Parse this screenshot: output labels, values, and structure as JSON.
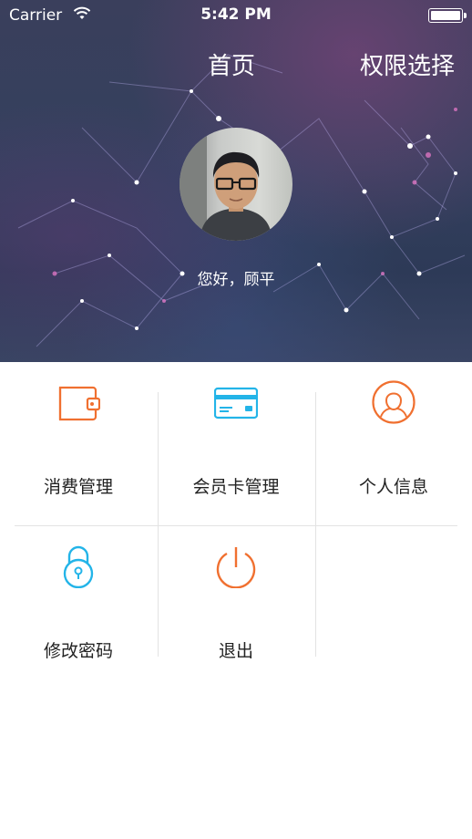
{
  "status_bar": {
    "carrier": "Carrier",
    "time": "5:42 PM"
  },
  "nav": {
    "home_title": "首页",
    "permission_button": "权限选择"
  },
  "profile": {
    "greeting": "您好，顾平"
  },
  "menu": [
    {
      "label": "消费管理",
      "icon": "wallet-icon",
      "color": "#f07030"
    },
    {
      "label": "会员卡管理",
      "icon": "card-icon",
      "color": "#23b4e8"
    },
    {
      "label": "个人信息",
      "icon": "person-icon",
      "color": "#f07030"
    },
    {
      "label": "修改密码",
      "icon": "lock-icon",
      "color": "#23b4e8"
    },
    {
      "label": "退出",
      "icon": "power-icon",
      "color": "#f07030"
    }
  ]
}
